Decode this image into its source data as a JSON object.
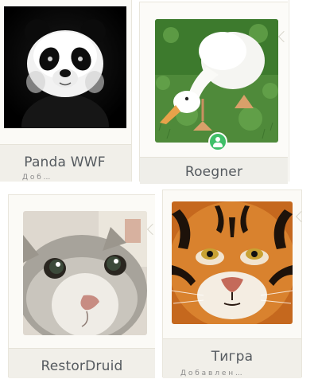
{
  "cards": [
    {
      "name": "Panda WWF",
      "subline": "Д о б ...",
      "online": false
    },
    {
      "name": "Roegner",
      "online": true
    },
    {
      "name": "RestorDruid",
      "online": false
    },
    {
      "name": "Тигра",
      "subline": "Д о б а в л е н ...",
      "online": false
    }
  ],
  "icons": {
    "online": "user-online-icon",
    "arrow": "chevron-left-icon"
  },
  "colors": {
    "card_bg": "#fbfaf6",
    "name_bar_bg": "#f1efe9",
    "name_text": "#555a5f",
    "online_green": "#3fbf68"
  }
}
